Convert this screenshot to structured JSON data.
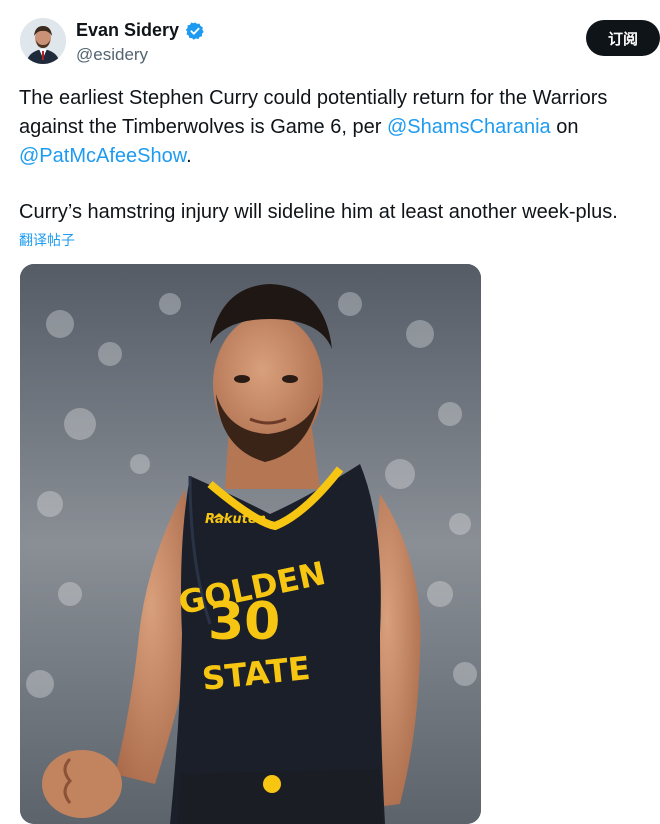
{
  "author": {
    "name": "Evan Sidery",
    "handle": "@esidery",
    "avatar_icon": "person-avatar-icon",
    "verified_icon": "verified-badge-icon",
    "verified_color": "#1d9bf0"
  },
  "subscribe_label": "订阅",
  "tweet": {
    "p1_part1": "The earliest Stephen Curry could potentially return for the Warriors against the Timberwolves is Game 6, per ",
    "mention1": "@ShamsCharania",
    "p1_part2": " on ",
    "mention2": "@PatMcAfeeShow",
    "p1_part3": ".",
    "p2": "Curry’s hamstring injury will sideline him at least another week-plus."
  },
  "translate_label": "翻译帖子",
  "media": {
    "jersey_line1": "GOLDEN",
    "jersey_number": "30",
    "jersey_line2": "STATE",
    "sponsor": "Rakuten",
    "colors": {
      "jersey": "#1b1f29",
      "lettering": "#f7c613",
      "skin": "#c88b67"
    }
  },
  "colors": {
    "accent": "#1d9bf0",
    "text": "#0f1419",
    "muted": "#536471"
  }
}
